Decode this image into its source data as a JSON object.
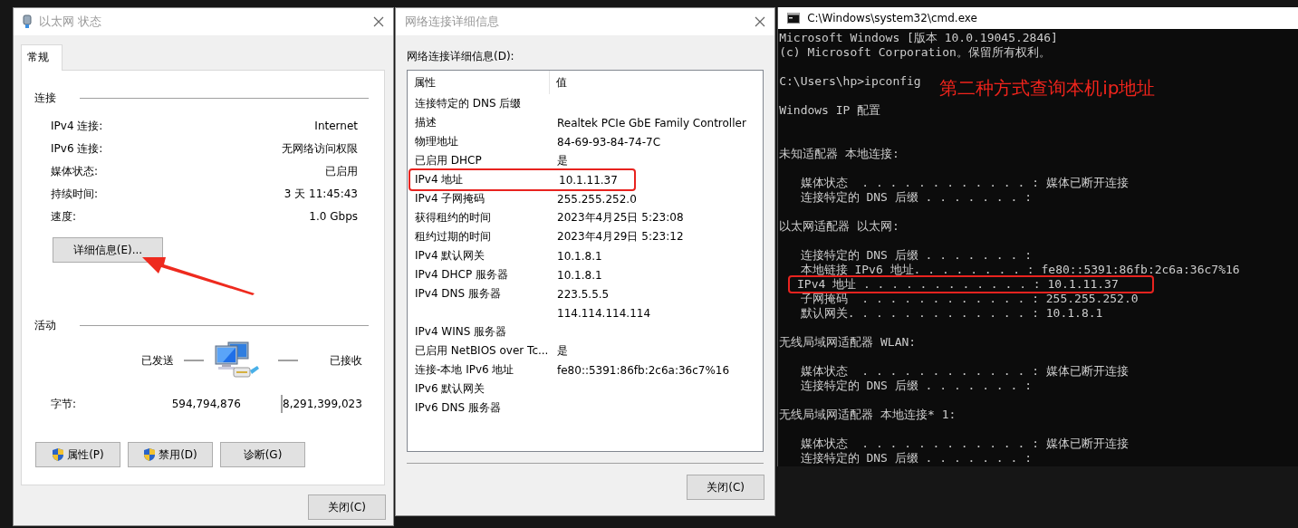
{
  "status_window": {
    "title": "以太网 状态",
    "tabs": [
      {
        "label": "常规",
        "selected": true
      }
    ],
    "connection": {
      "heading": "连接",
      "rows": [
        {
          "label": "IPv4 连接:",
          "value": "Internet"
        },
        {
          "label": "IPv6 连接:",
          "value": "无网络访问权限"
        },
        {
          "label": "媒体状态:",
          "value": "已启用"
        },
        {
          "label": "持续时间:",
          "value": "3 天 11:45:43"
        },
        {
          "label": "速度:",
          "value": "1.0 Gbps"
        }
      ],
      "details_button": "详细信息(E)..."
    },
    "activity": {
      "heading": "活动",
      "sent_label": "已发送",
      "received_label": "已接收",
      "bytes_label": "字节:",
      "sent": "594,794,876",
      "received": "8,291,399,023"
    },
    "buttons": [
      {
        "label": "属性(P)",
        "shield": true
      },
      {
        "label": "禁用(D)",
        "shield": true
      },
      {
        "label": "诊断(G)",
        "shield": false
      }
    ],
    "close_button": "关闭(C)"
  },
  "details_window": {
    "title": "网络连接详细信息",
    "list_label": "网络连接详细信息(D):",
    "columns": [
      "属性",
      "值"
    ],
    "rows": [
      {
        "property": "连接特定的 DNS 后缀",
        "highlighted": false
      },
      {
        "property": "描述",
        "value": "Realtek PCIe GbE Family Controller",
        "highlighted": false
      },
      {
        "property": "物理地址",
        "value": "84-69-93-84-74-7C",
        "highlighted": false
      },
      {
        "property": "已启用 DHCP",
        "value": "是",
        "highlighted": false
      },
      {
        "property": "IPv4 地址",
        "value": "10.1.11.37",
        "highlighted": true
      },
      {
        "property": "IPv4 子网掩码",
        "value": "255.255.252.0",
        "highlighted": false
      },
      {
        "property": "获得租约的时间",
        "value": "2023年4月25日 5:23:08",
        "highlighted": false
      },
      {
        "property": "租约过期的时间",
        "value": "2023年4月29日 5:23:12",
        "highlighted": false
      },
      {
        "property": "IPv4 默认网关",
        "value": "10.1.8.1",
        "highlighted": false
      },
      {
        "property": "IPv4 DHCP 服务器",
        "value": "10.1.8.1",
        "highlighted": false
      },
      {
        "property": "IPv4 DNS 服务器",
        "value": "223.5.5.5",
        "highlighted": false
      },
      {
        "value": "114.114.114.114",
        "highlighted": false
      },
      {
        "property": "IPv4 WINS 服务器",
        "highlighted": false
      },
      {
        "property": "已启用 NetBIOS over Tc...",
        "value": "是",
        "highlighted": false
      },
      {
        "property": "连接-本地 IPv6 地址",
        "value": "fe80::5391:86fb:2c6a:36c7%16",
        "highlighted": false
      },
      {
        "property": "IPv6 默认网关",
        "highlighted": false
      },
      {
        "property": "IPv6 DNS 服务器",
        "highlighted": false
      }
    ],
    "close_button": "关闭(C)"
  },
  "console_window": {
    "title": "C:\\Windows\\system32\\cmd.exe",
    "annotation": "第二种方式查询本机ip地址",
    "lines": [
      {
        "text": "Microsoft Windows [版本 10.0.19045.2846]",
        "kind": "line",
        "highlighted": false
      },
      {
        "text": "(c) Microsoft Corporation。保留所有权利。",
        "kind": "line",
        "highlighted": false
      },
      {
        "text": "C:\\Users\\hp>ipconfig",
        "kind": "after_blank",
        "highlighted": false
      },
      {
        "text": "Windows IP 配置",
        "kind": "after_blank",
        "highlighted": false
      },
      {
        "text": "未知适配器 本地连接:",
        "kind": "after_two_blanks",
        "highlighted": false
      },
      {
        "text": "   媒体状态  . . . . . . . . . . . . : 媒体已断开连接",
        "kind": "after_blank",
        "highlighted": false
      },
      {
        "text": "   连接特定的 DNS 后缀 . . . . . . . :",
        "kind": "line",
        "highlighted": false
      },
      {
        "text": "以太网适配器 以太网:",
        "kind": "after_blank",
        "highlighted": false
      },
      {
        "text": "   连接特定的 DNS 后缀 . . . . . . . :",
        "kind": "after_blank",
        "highlighted": false
      },
      {
        "text": "   本地链接 IPv6 地址. . . . . . . . : fe80::5391:86fb:2c6a:36c7%16",
        "kind": "line",
        "highlighted": false
      },
      {
        "text": "   IPv4 地址 . . . . . . . . . . . . : 10.1.11.37",
        "kind": "line",
        "highlighted": true
      },
      {
        "text": "   子网掩码  . . . . . . . . . . . . : 255.255.252.0",
        "kind": "line",
        "highlighted": false
      },
      {
        "text": "   默认网关. . . . . . . . . . . . . : 10.1.8.1",
        "kind": "line",
        "highlighted": false
      },
      {
        "text": "无线局域网适配器 WLAN:",
        "kind": "after_blank",
        "highlighted": false
      },
      {
        "text": "   媒体状态  . . . . . . . . . . . . : 媒体已断开连接",
        "kind": "after_blank",
        "highlighted": false
      },
      {
        "text": "   连接特定的 DNS 后缀 . . . . . . . :",
        "kind": "line",
        "highlighted": false
      },
      {
        "text": "无线局域网适配器 本地连接* 1:",
        "kind": "after_blank",
        "highlighted": false
      },
      {
        "text": "   媒体状态  . . . . . . . . . . . . : 媒体已断开连接",
        "kind": "after_blank",
        "highlighted": false
      },
      {
        "text": "   连接特定的 DNS 后缀 . . . . . . . :",
        "kind": "line",
        "highlighted": false
      }
    ]
  }
}
